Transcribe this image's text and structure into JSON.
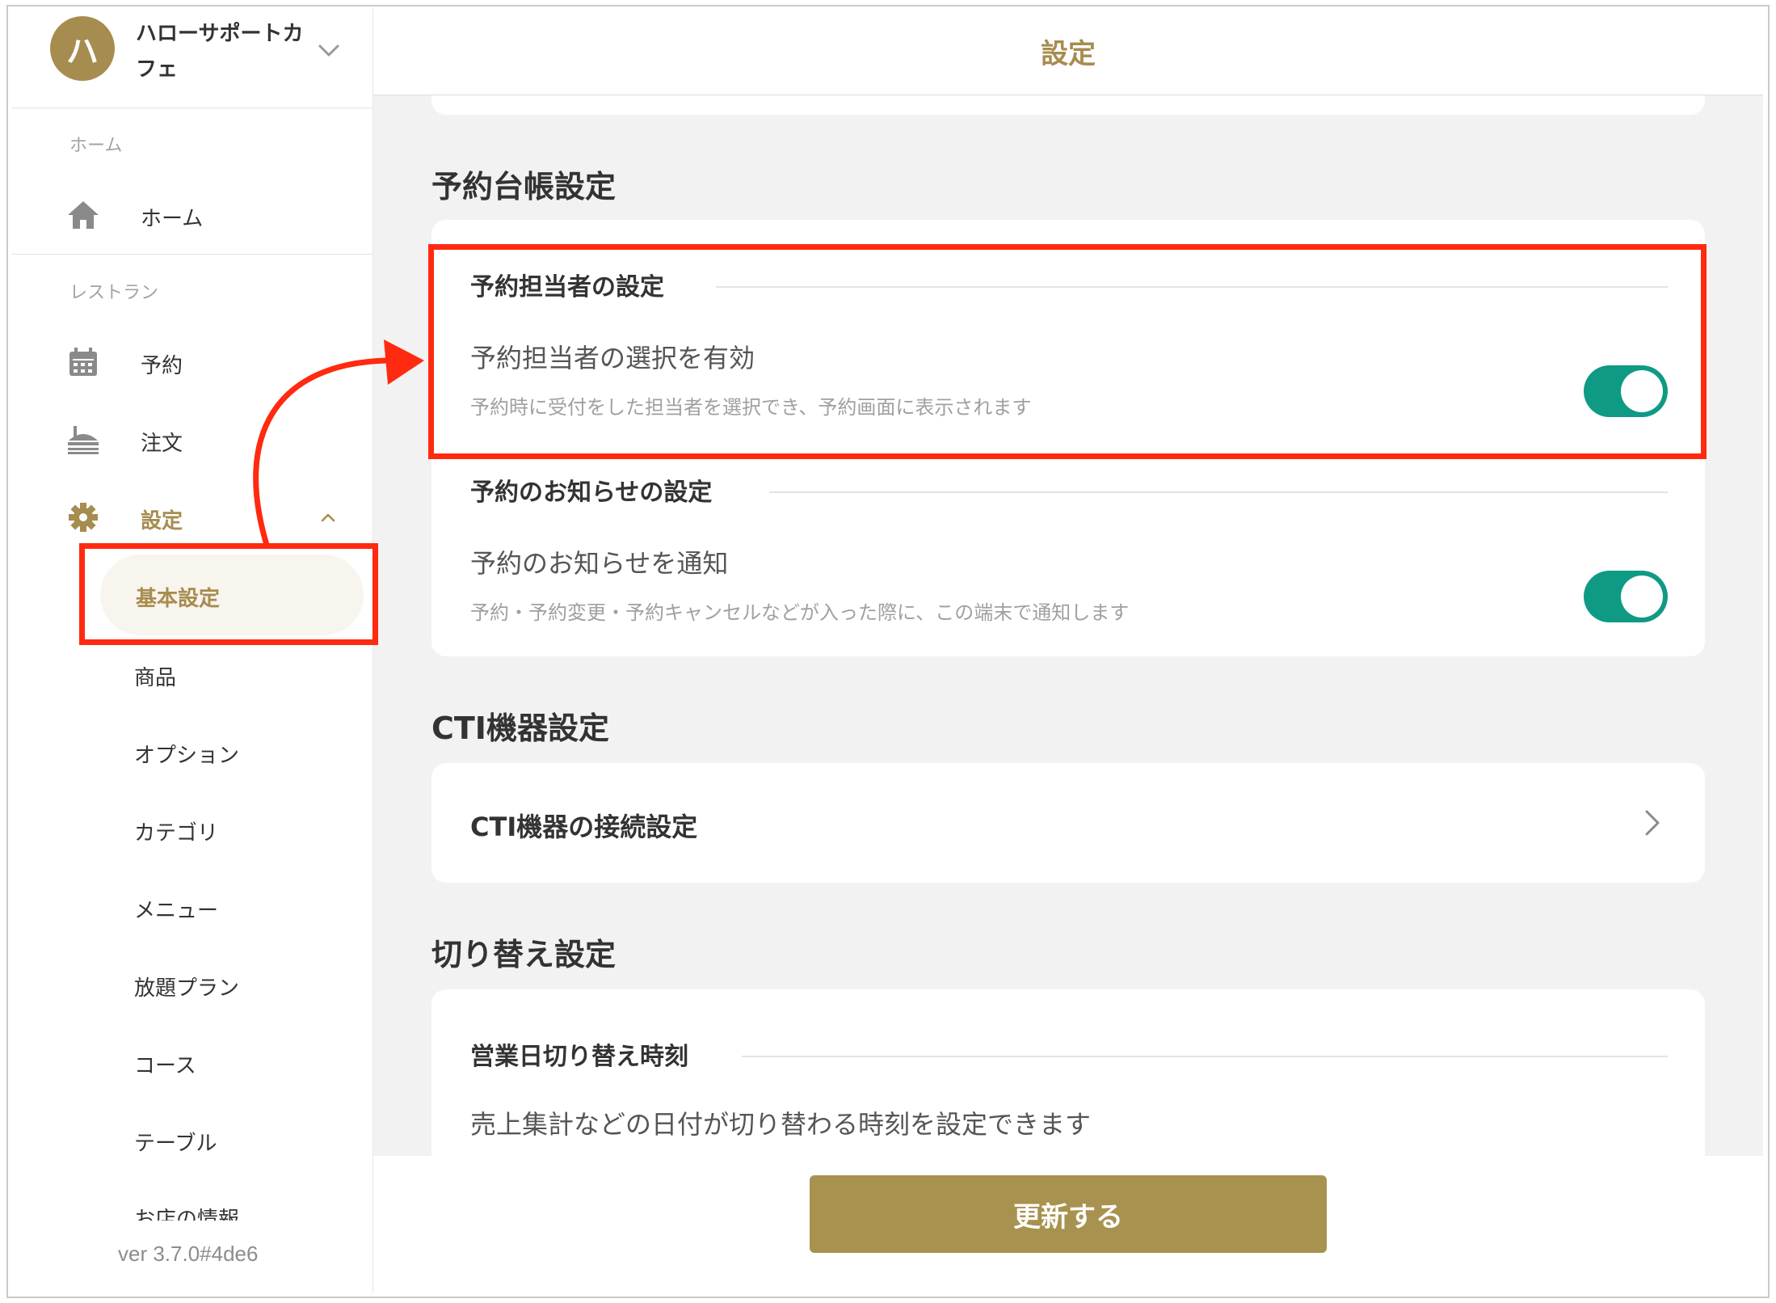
{
  "colors": {
    "accent": "#a78c4f",
    "toggle_on": "#0f9a86",
    "annotation": "#ff2a0f",
    "main_bg": "#f2f2f2"
  },
  "sidebar": {
    "shop": {
      "avatar_text": "ハ",
      "name": "ハローサポートカフェ",
      "dropdown_icon": "chevron-down-icon"
    },
    "sections": {
      "home": "ホーム",
      "restaurant": "レストラン"
    },
    "items": {
      "home": {
        "label": "ホーム",
        "icon": "home-icon"
      },
      "reservation": {
        "label": "予約",
        "icon": "calendar-icon"
      },
      "order": {
        "label": "注文",
        "icon": "order-tray-icon"
      },
      "settings": {
        "label": "設定",
        "icon": "gear-icon",
        "expanded": true
      }
    },
    "sub_items": {
      "basic": "基本設定",
      "products": "商品",
      "options": "オプション",
      "category": "カテゴリ",
      "menu": "メニュー",
      "plan": "放題プラン",
      "course": "コース",
      "table": "テーブル",
      "shop_info": "お店の情報"
    },
    "version": "ver 3.7.0#4de6"
  },
  "header": {
    "title": "設定"
  },
  "ledger": {
    "title": "予約台帳設定",
    "staff": {
      "heading": "予約担当者の設定",
      "title": "予約担当者の選択を有効",
      "desc": "予約時に受付をした担当者を選択でき、予約画面に表示されます",
      "enabled": true
    },
    "notice": {
      "heading": "予約のお知らせの設定",
      "title": "予約のお知らせを通知",
      "desc": "予約・予約変更・予約キャンセルなどが入った際に、この端末で通知します",
      "enabled": true
    }
  },
  "cti": {
    "title": "CTI機器設定",
    "item": "CTI機器の接続設定"
  },
  "switch": {
    "title": "切り替え設定",
    "heading": "営業日切り替え時刻",
    "desc": "売上集計などの日付が切り替わる時刻を設定できます"
  },
  "footer": {
    "update_label": "更新する"
  }
}
